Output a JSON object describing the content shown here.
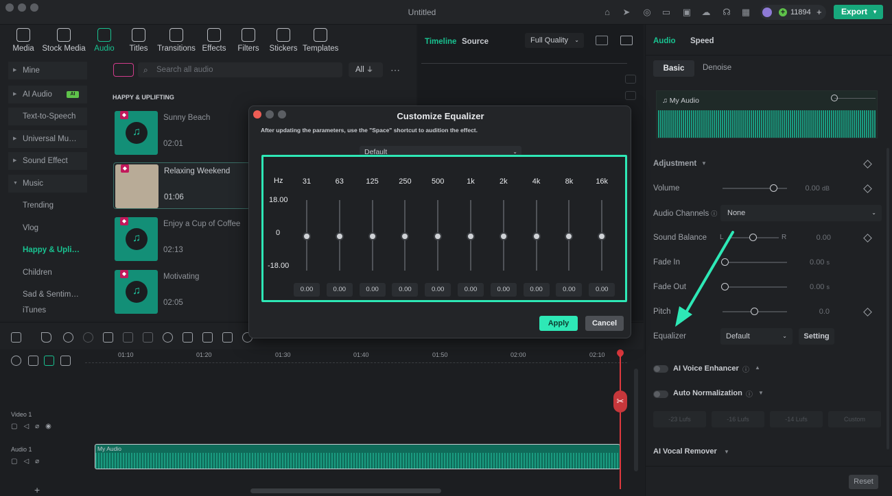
{
  "window": {
    "title": "Untitled",
    "credits": "11894",
    "export_label": "Export"
  },
  "toolbar": {
    "items": [
      "Media",
      "Stock Media",
      "Audio",
      "Titles",
      "Transitions",
      "Effects",
      "Filters",
      "Stickers",
      "Templates"
    ],
    "active": "Audio"
  },
  "sidebar": {
    "items": [
      "Mine",
      "AI Audio",
      "Text-to-Speech",
      "Universal Mu…",
      "Sound Effect",
      "Music",
      "Trending",
      "Vlog",
      "Happy & Upli…",
      "Children",
      "Sad & Sentim…",
      "iTunes"
    ],
    "ai_badge": "AI"
  },
  "search": {
    "placeholder": "Search all audio",
    "filter_label": "All"
  },
  "library": {
    "section_title": "HAPPY & UPLIFTING",
    "tracks": [
      {
        "name": "Sunny Beach",
        "duration": "02:01"
      },
      {
        "name": "Relaxing Weekend",
        "duration": "01:06"
      },
      {
        "name": "Enjoy a Cup of Coffee",
        "duration": "02:13"
      },
      {
        "name": "Motivating",
        "duration": "02:05"
      }
    ]
  },
  "preview": {
    "tabs": [
      "Timeline",
      "Source"
    ],
    "quality": "Full Quality"
  },
  "timeline": {
    "ruler": [
      "01:10",
      "01:20",
      "01:30",
      "01:40",
      "01:50",
      "02:00",
      "02:10"
    ],
    "tracks": [
      "Video 1",
      "Audio 1"
    ],
    "clip_label": "My Audio"
  },
  "props": {
    "tabs": [
      "Audio",
      "Speed"
    ],
    "subtabs": [
      "Basic",
      "Denoise"
    ],
    "clip_name": "My Audio",
    "adjustment_title": "Adjustment",
    "volume": {
      "label": "Volume",
      "value": "0.00",
      "unit": "dB",
      "level": 0.55
    },
    "channels": {
      "label": "Audio Channels",
      "value": "None"
    },
    "balance": {
      "label": "Sound Balance",
      "value": "0.00",
      "left": "L",
      "right": "R",
      "level": 0.5
    },
    "fade_in": {
      "label": "Fade In",
      "value": "0.00",
      "unit": "s"
    },
    "fade_out": {
      "label": "Fade Out",
      "value": "0.00",
      "unit": "s"
    },
    "pitch": {
      "label": "Pitch",
      "value": "0.0",
      "level": 0.5
    },
    "equalizer": {
      "label": "Equalizer",
      "value": "Default",
      "setting_label": "Setting"
    },
    "voice_enhancer": "AI Voice Enhancer",
    "auto_norm": "Auto Normalization",
    "lufs_chips": [
      "-23 Lufs",
      "-16 Lufs",
      "-14 Lufs",
      "Custom"
    ],
    "vocal_remover": "AI Vocal Remover",
    "reset_label": "Reset"
  },
  "equalizer_dialog": {
    "title": "Customize Equalizer",
    "hint": "After updating the parameters, use the \"Space\" shortcut to audition the effect.",
    "preset": "Default",
    "hz_label": "Hz",
    "db_max": "18.00",
    "db_mid": "0",
    "db_min": "-18.00",
    "bands": [
      {
        "freq": "31",
        "value": "0.00"
      },
      {
        "freq": "63",
        "value": "0.00"
      },
      {
        "freq": "125",
        "value": "0.00"
      },
      {
        "freq": "250",
        "value": "0.00"
      },
      {
        "freq": "500",
        "value": "0.00"
      },
      {
        "freq": "1k",
        "value": "0.00"
      },
      {
        "freq": "2k",
        "value": "0.00"
      },
      {
        "freq": "4k",
        "value": "0.00"
      },
      {
        "freq": "8k",
        "value": "0.00"
      },
      {
        "freq": "16k",
        "value": "0.00"
      }
    ],
    "apply_label": "Apply",
    "cancel_label": "Cancel"
  },
  "colors": {
    "accent": "#19c391",
    "highlight": "#2ee8b6",
    "playhead": "#e0393e"
  }
}
